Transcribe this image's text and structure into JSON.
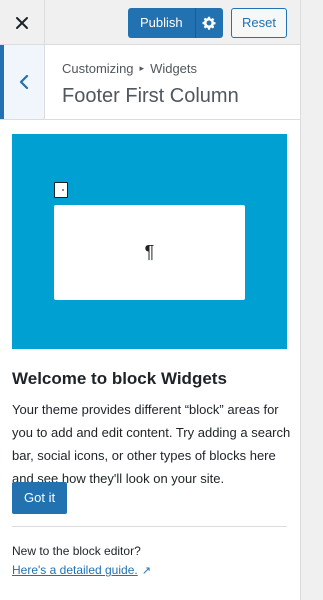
{
  "topbar": {
    "close_icon": "close-icon",
    "publish_label": "Publish",
    "settings_icon": "gear-icon",
    "reset_label": "Reset"
  },
  "section": {
    "back_icon": "chevron-left-icon",
    "breadcrumb_parent": "Customizing",
    "breadcrumb_child": "Widgets",
    "title": "Footer First Column"
  },
  "welcome": {
    "pilcrow": "¶",
    "title": "Welcome to block Widgets",
    "body": "Your theme provides different “block” areas for you to add and edit content. Try adding a search bar, social icons, or other types of blocks here and see how they'll look on your site.",
    "button_label": "Got it",
    "new_text": "New to the block editor?",
    "guide_link": "Here's a detailed guide.",
    "guide_icon": "external-link-icon"
  },
  "colors": {
    "accent": "#2271b1",
    "hero_bg": "#00a0d2"
  }
}
